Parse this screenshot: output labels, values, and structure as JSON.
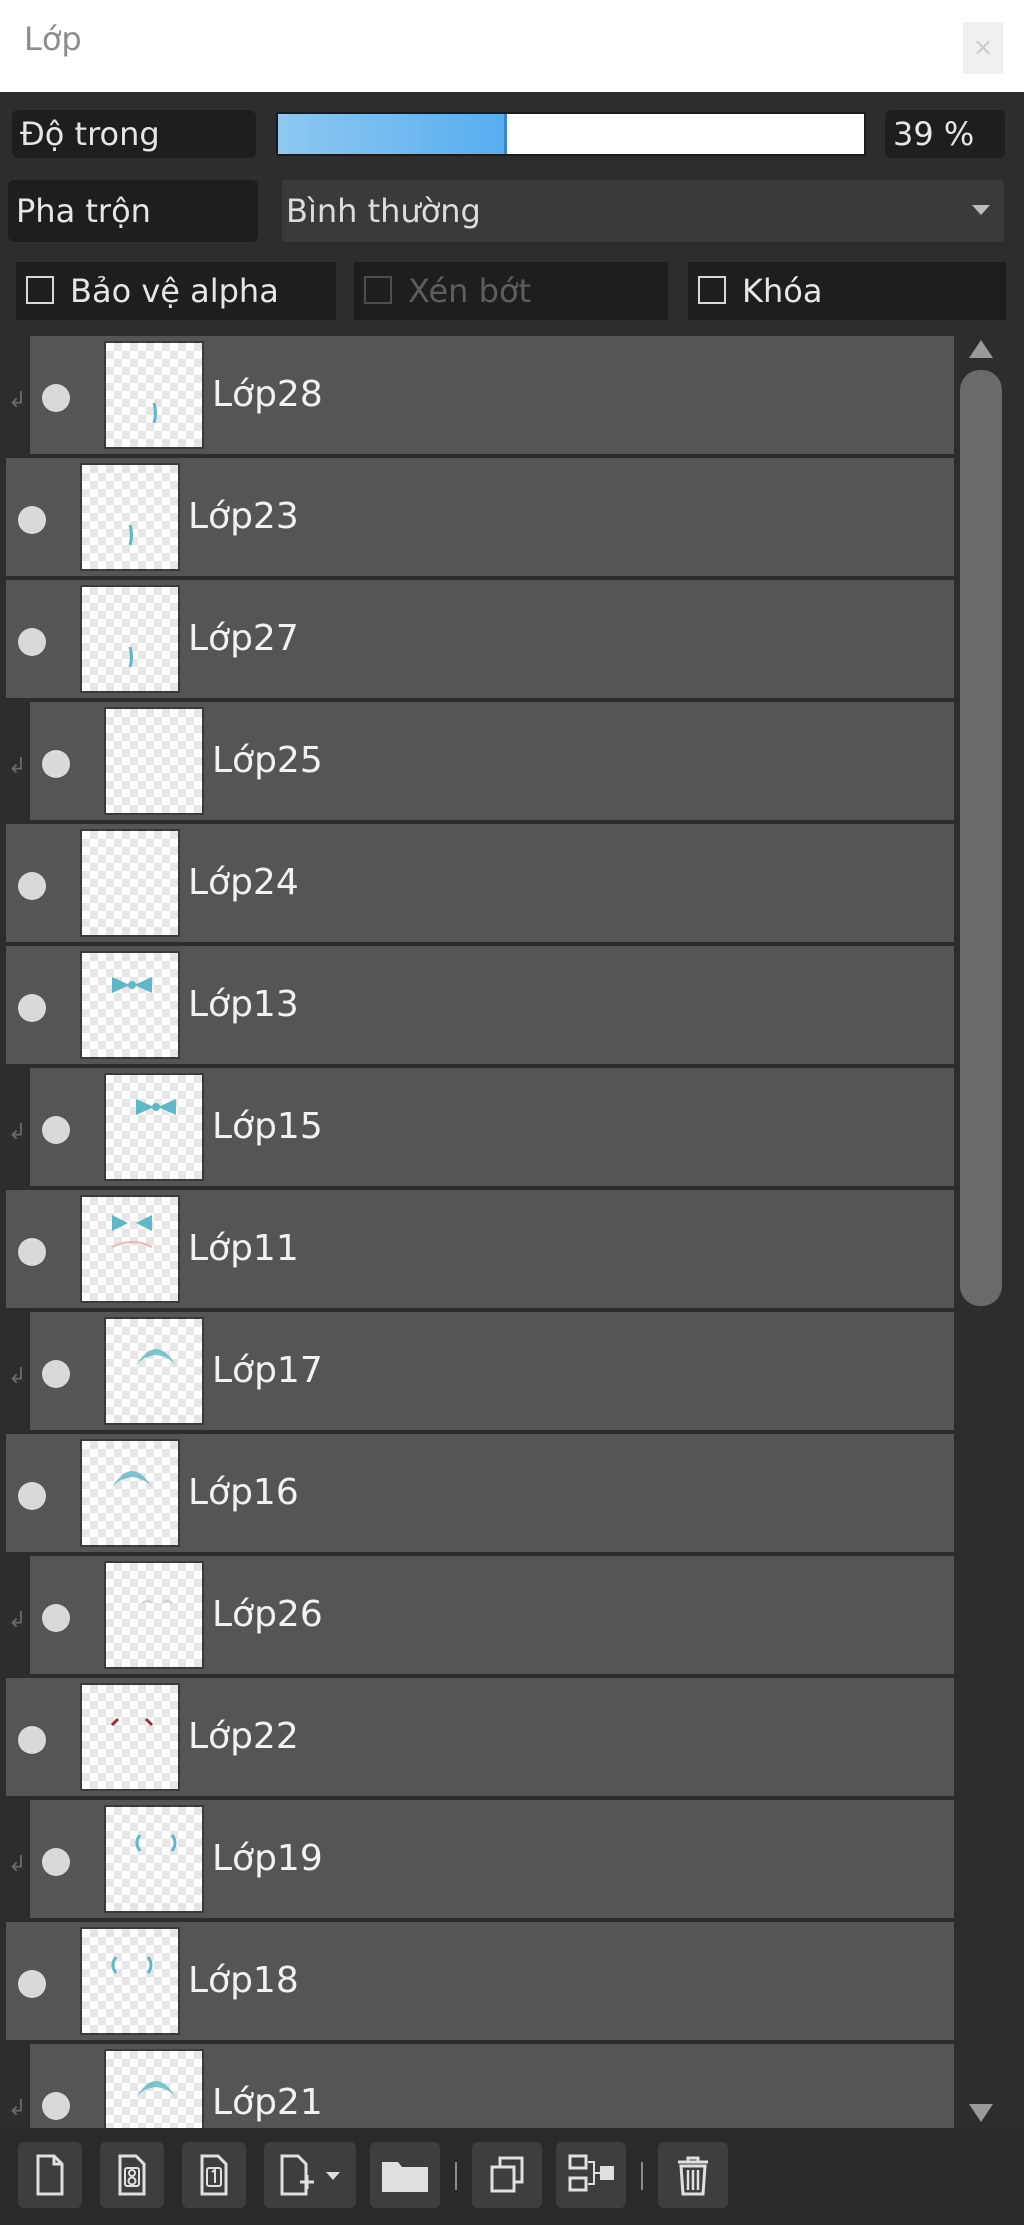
{
  "window": {
    "title": "Lớp",
    "close_label": "×"
  },
  "opacity": {
    "label": "Độ trong",
    "value": "39 %",
    "fraction": 0.39
  },
  "blend": {
    "label": "Pha trộn",
    "mode": "Bình thường"
  },
  "options": [
    {
      "label": "Bảo vệ alpha",
      "checked": false,
      "enabled": true
    },
    {
      "label": "Xén bớt",
      "checked": false,
      "enabled": false
    },
    {
      "label": "Khóa",
      "checked": false,
      "enabled": true
    }
  ],
  "layers": [
    {
      "name": "Lớp28",
      "clipped": true,
      "thumb": "mark"
    },
    {
      "name": "Lớp23",
      "clipped": false,
      "thumb": "mark"
    },
    {
      "name": "Lớp27",
      "clipped": false,
      "thumb": "mark"
    },
    {
      "name": "Lớp25",
      "clipped": true,
      "thumb": "blank"
    },
    {
      "name": "Lớp24",
      "clipped": false,
      "thumb": "blank"
    },
    {
      "name": "Lớp13",
      "clipped": false,
      "thumb": "bow"
    },
    {
      "name": "Lớp15",
      "clipped": true,
      "thumb": "bow"
    },
    {
      "name": "Lớp11",
      "clipped": false,
      "thumb": "bow-face"
    },
    {
      "name": "Lớp17",
      "clipped": true,
      "thumb": "hair"
    },
    {
      "name": "Lớp16",
      "clipped": false,
      "thumb": "hair"
    },
    {
      "name": "Lớp26",
      "clipped": true,
      "thumb": "faint"
    },
    {
      "name": "Lớp22",
      "clipped": false,
      "thumb": "red"
    },
    {
      "name": "Lớp19",
      "clipped": true,
      "thumb": "parens"
    },
    {
      "name": "Lớp18",
      "clipped": false,
      "thumb": "parens"
    },
    {
      "name": "Lớp21",
      "clipped": true,
      "thumb": "hair"
    }
  ],
  "toolbar": {
    "buttons": [
      "new-layer",
      "new-8bit-layer",
      "new-1bit-layer",
      "add-layer-dropdown",
      "new-folder",
      "duplicate-layer",
      "merge-down",
      "delete-layer"
    ]
  },
  "colors": {
    "accent": "#57aef0",
    "panel": "#2d2d2d",
    "row": "#555555",
    "thumb_teal": "#5fb8c8"
  }
}
